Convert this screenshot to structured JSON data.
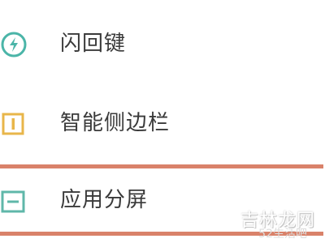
{
  "menu": {
    "items": [
      {
        "label": "闪回键",
        "icon": "flash-back-icon",
        "color": "#4bb5a8"
      },
      {
        "label": "智能侧边栏",
        "icon": "smart-sidebar-icon",
        "color": "#e8b64a"
      },
      {
        "label": "应用分屏",
        "icon": "split-screen-icon",
        "color": "#5fb7a9"
      }
    ],
    "highlight_color": "#d9826a"
  },
  "watermark": {
    "main": "吉林龙网",
    "sub": "52生活吧"
  }
}
